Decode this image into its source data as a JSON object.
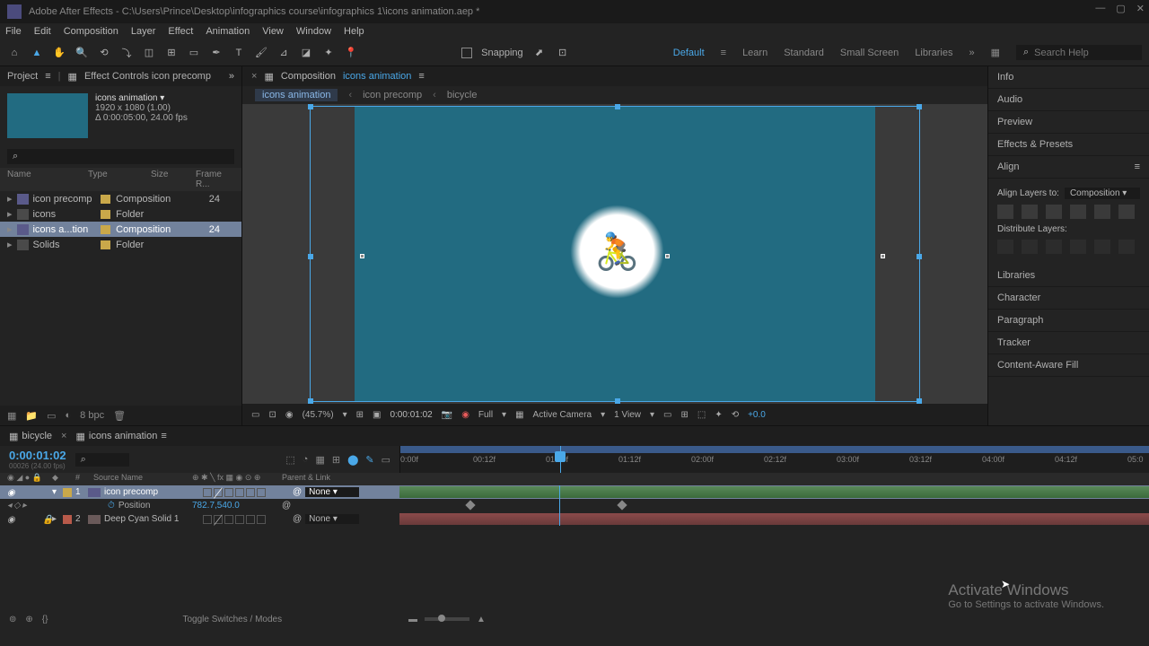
{
  "title": "Adobe After Effects - C:\\Users\\Prince\\Desktop\\infographics course\\infographics 1\\icons animation.aep *",
  "menu": [
    "File",
    "Edit",
    "Composition",
    "Layer",
    "Effect",
    "Animation",
    "View",
    "Window",
    "Help"
  ],
  "toolbar": {
    "snapping": "Snapping"
  },
  "workspaces": {
    "items": [
      "Default",
      "Learn",
      "Standard",
      "Small Screen",
      "Libraries"
    ],
    "active": "Default"
  },
  "search_placeholder": "Search Help",
  "project_panel": {
    "tab_project": "Project",
    "tab_effectcontrols": "Effect Controls icon precomp",
    "comp_name": "icons animation ▾",
    "comp_res": "1920 x 1080 (1.00)",
    "comp_dur": "Δ 0:00:05:00, 24.00 fps",
    "columns": [
      "Name",
      "Type",
      "Size",
      "Frame R..."
    ],
    "items": [
      {
        "name": "icon precomp",
        "type": "Composition",
        "fr": "24",
        "kind": "comp"
      },
      {
        "name": "icons",
        "type": "Folder",
        "fr": "",
        "kind": "folder"
      },
      {
        "name": "icons a...tion",
        "type": "Composition",
        "fr": "24",
        "kind": "comp",
        "sel": true
      },
      {
        "name": "Solids",
        "type": "Folder",
        "fr": "",
        "kind": "folder"
      }
    ],
    "bpc": "8 bpc"
  },
  "comp_panel": {
    "prefix": "Composition",
    "name": "icons animation",
    "breadcrumb": [
      "icons animation",
      "icon precomp",
      "bicycle"
    ],
    "footer": {
      "zoom": "(45.7%)",
      "time": "0:00:01:02",
      "res": "Full",
      "camera": "Active Camera",
      "view": "1 View",
      "exp": "+0.0"
    }
  },
  "right_panels": [
    "Info",
    "Audio",
    "Preview",
    "Effects & Presets"
  ],
  "align": {
    "title": "Align",
    "layers_to": "Align Layers to:",
    "target": "Composition",
    "distribute": "Distribute Layers:"
  },
  "right_panels2": [
    "Libraries",
    "Character",
    "Paragraph",
    "Tracker",
    "Content-Aware Fill"
  ],
  "timeline": {
    "tabs": [
      {
        "name": "bicycle"
      },
      {
        "name": "icons animation",
        "active": true
      }
    ],
    "timecode": "0:00:01:02",
    "frame_info": "00026 (24.00 fps)",
    "ruler": [
      "0:00f",
      "00:12f",
      "01:00f",
      "01:12f",
      "02:00f",
      "02:12f",
      "03:00f",
      "03:12f",
      "04:00f",
      "04:12f",
      "05:0"
    ],
    "col_source": "Source Name",
    "col_parent": "Parent & Link",
    "layers": [
      {
        "num": "1",
        "name": "icon precomp",
        "parent": "None",
        "sel": true,
        "color": "#c9a84a",
        "bar": "teal"
      },
      {
        "num": "2",
        "name": "Deep Cyan Solid 1",
        "parent": "None",
        "color": "#b85a4a",
        "bar": "red",
        "locked": true
      }
    ],
    "prop": {
      "name": "Position",
      "value": "782.7,540.0"
    },
    "footer": "Toggle Switches / Modes"
  },
  "activate": {
    "title": "Activate Windows",
    "sub": "Go to Settings to activate Windows."
  }
}
